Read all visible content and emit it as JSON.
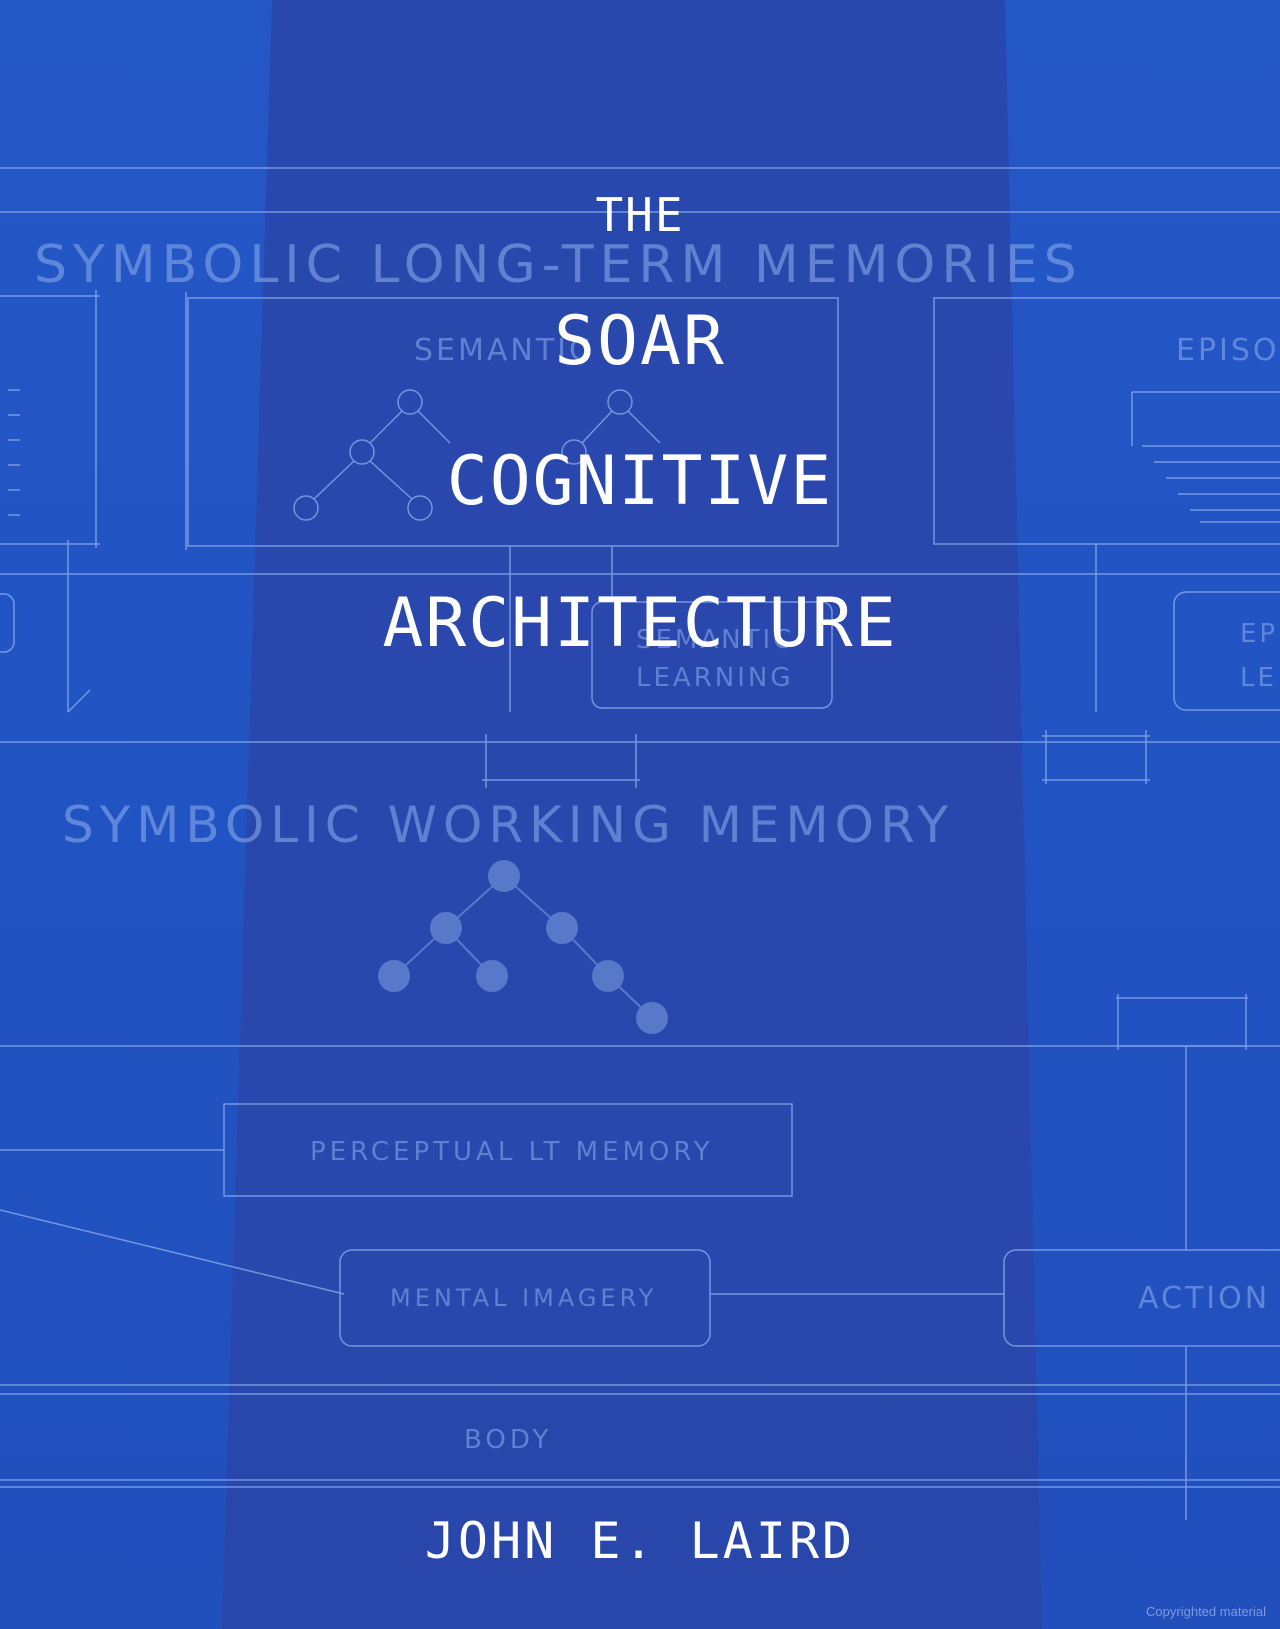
{
  "cover": {
    "title_line_1": "THE",
    "title_line_2": "SOAR",
    "title_line_3": "COGNITIVE",
    "title_line_4": "ARCHITECTURE",
    "author": "JOHN E. LAIRD",
    "copyright_notice": "Copyrighted material"
  },
  "blueprint_labels": {
    "long_term": "SYMBOLIC LONG-TERM MEMORIES",
    "semantic": "SEMANTIC",
    "episodic": "EPISO",
    "semantic_learning_1": "SEMANTIC",
    "semantic_learning_2": "LEARNING",
    "episodic_learning_1": "EP",
    "episodic_learning_2": "LE",
    "working_memory": "SYMBOLIC WORKING MEMORY",
    "perceptual": "PERCEPTUAL LT MEMORY",
    "imagery": "MENTAL IMAGERY",
    "action": "ACTION",
    "body": "BODY"
  },
  "colors": {
    "background": "#2354c4",
    "center_band": "#2a45a8",
    "sketch_lines": "#8fb0f0",
    "title_text": "#ffffff"
  }
}
